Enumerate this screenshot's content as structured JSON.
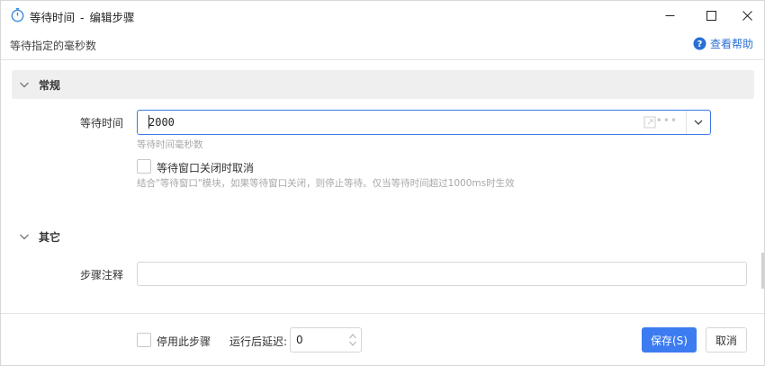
{
  "window": {
    "title": "等待时间",
    "title_separator": "-",
    "title_suffix": "编辑步骤",
    "icon": "stopwatch-icon"
  },
  "subtitle": "等待指定的毫秒数",
  "help": {
    "label": "查看帮助",
    "icon": "question-circle-icon"
  },
  "sections": {
    "general": {
      "label": "常规",
      "icon": "chevron-down-icon"
    },
    "other": {
      "label": "其它",
      "icon": "chevron-down-icon"
    }
  },
  "fields": {
    "wait_time": {
      "label": "等待时间",
      "value": "2000",
      "hint": "等待时间毫秒数",
      "dots": "•••"
    },
    "cancel_on_close": {
      "label": "等待窗口关闭时取消",
      "checked": false,
      "hint": "结合\"等待窗口\"模块，如果等待窗口关闭，则停止等待。仅当等待时间超过1000ms时生效"
    },
    "step_note": {
      "label": "步骤注释",
      "value": ""
    }
  },
  "footer": {
    "disable_step": {
      "label": "停用此步骤",
      "checked": false
    },
    "delay_label": "运行后延迟:",
    "delay_value": "0",
    "save_label": "保存(S)",
    "cancel_label": "取消"
  },
  "colors": {
    "accent": "#3c7cf0",
    "focus_border": "#3b78e7",
    "link": "#2a6fd6",
    "section_bg": "#efefef"
  }
}
